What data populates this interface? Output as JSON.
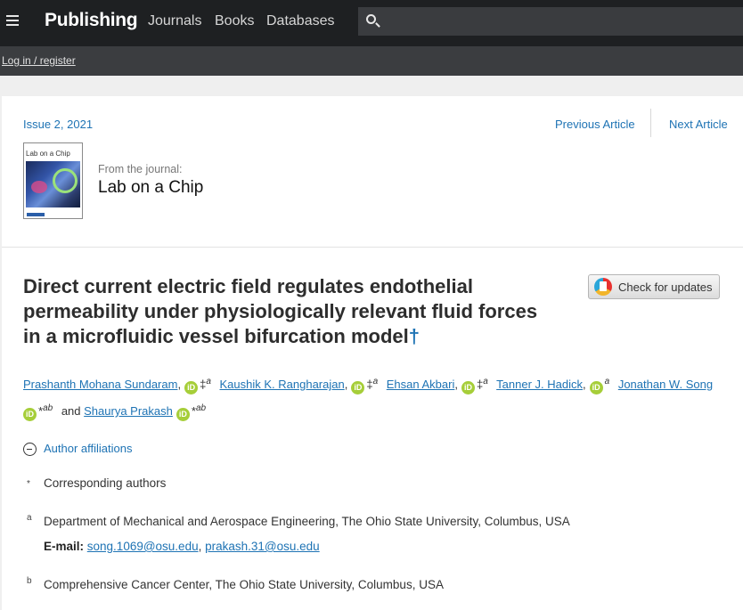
{
  "header": {
    "brand": "Publishing",
    "nav": [
      "Journals",
      "Books",
      "Databases"
    ],
    "search": {
      "value": "",
      "placeholder": ""
    },
    "login": "Log in / register"
  },
  "article_nav": {
    "issue": "Issue 2, 2021",
    "previous": "Previous Article",
    "next": "Next Article"
  },
  "journal": {
    "cover_title": "Lab on a Chip",
    "from_label": "From the journal:",
    "name": "Lab on a Chip"
  },
  "article": {
    "title": "Direct current electric field regulates endothelial permeability under physiologically relevant fluid forces in a microfluidic vessel bifurcation model",
    "dagger": "†",
    "check_updates": "Check for updates"
  },
  "authors": [
    {
      "name": "Prashanth Mohana Sundaram",
      "marks": "‡",
      "aff": "a"
    },
    {
      "name": "Kaushik K. Rangharajan",
      "marks": "‡",
      "aff": "a"
    },
    {
      "name": "Ehsan Akbari",
      "marks": "‡",
      "aff": "a"
    },
    {
      "name": "Tanner J. Hadick",
      "marks": "",
      "aff": "a"
    },
    {
      "name": "Jonathan W. Song",
      "marks": "*",
      "aff": "ab"
    },
    {
      "name": "Shaurya Prakash",
      "marks": "*",
      "aff": "ab"
    }
  ],
  "authors_and": "and",
  "orcid_label": "iD",
  "affiliations": {
    "toggle_label": "Author affiliations",
    "corresponding_mark": "*",
    "corresponding": "Corresponding authors",
    "a_mark": "a",
    "a_text": "Department of Mechanical and Aerospace Engineering, The Ohio State University, Columbus, USA",
    "email_label": "E-mail:",
    "emails": [
      "song.1069@osu.edu",
      "prakash.31@osu.edu"
    ],
    "b_mark": "b",
    "b_text": "Comprehensive Cancer Center, The Ohio State University, Columbus, USA"
  }
}
